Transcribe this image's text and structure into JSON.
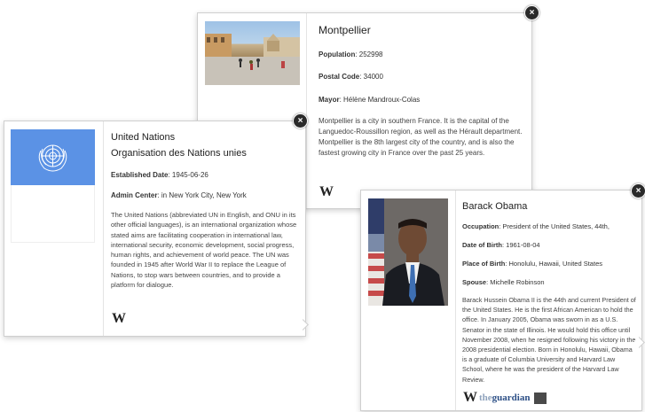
{
  "montpellier": {
    "title": "Montpellier",
    "population_label": "Population",
    "population_value": ": 252998",
    "postal_label": "Postal Code",
    "postal_value": ": 34000",
    "mayor_label": "Mayor",
    "mayor_value": ": Hélène Mandroux-Colas",
    "description": "Montpellier is a city in southern France. It is the capital of the Languedoc-Roussillon region, as well as the Hérault department. Montpellier is the 8th largest city of the country, and is also the fastest growing city in France over the past 25 years.",
    "source": "W"
  },
  "un": {
    "title": "United Nations",
    "subtitle": "Organisation des Nations unies",
    "established_label": "Established Date",
    "established_value": ": 1945-06-26",
    "admin_label": "Admin Center",
    "admin_value": ": in New York City, New York",
    "description": "The United Nations (abbreviated UN in English, and ONU in its other official languages), is an international organization whose stated aims are facilitating cooperation in international law, international security, economic development, social progress, human rights, and achievement of world peace. The UN was founded in 1945 after World War II to replace the League of Nations, to stop wars between countries, and to provide a platform for dialogue.",
    "source": "W",
    "flag_color": "#5b92e5"
  },
  "obama": {
    "title": "Barack Obama",
    "occupation_label": "Occupation",
    "occupation_value": ": President of the United States, 44th,",
    "dob_label": "Date of Birth",
    "dob_value": ": 1961-08-04",
    "pob_label": "Place of Birth",
    "pob_value": ": Honolulu, Hawaii, United States",
    "spouse_label": "Spouse",
    "spouse_value": ": Michelle Robinson",
    "description": "Barack Hussein Obama II is the 44th and current President of the United States. He is the first African American to hold the office. In January 2005, Obama was sworn in as a U.S. Senator in the state of Illinois. He would hold this office until November 2008, when he resigned following his victory in the 2008 presidential election. Born in Honolulu, Hawaii, Obama is a graduate of Columbia University and Harvard Law School, where he was the president of the Harvard Law Review.",
    "source_wiki": "W",
    "source_guardian_the": "the",
    "source_guardian_name": "guardian"
  },
  "close_glyph": "×"
}
